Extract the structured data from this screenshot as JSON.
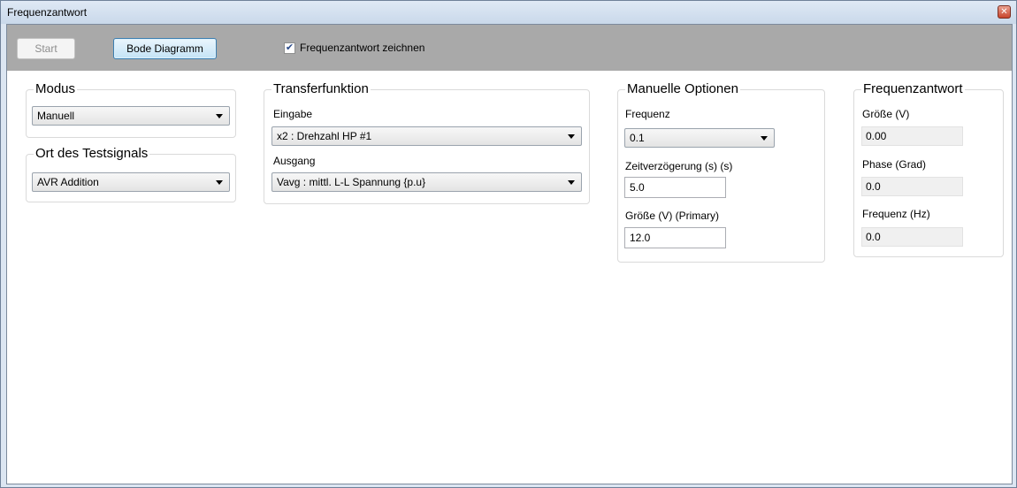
{
  "window": {
    "title": "Frequenzantwort"
  },
  "toolbar": {
    "start_label": "Start",
    "bode_label": "Bode Diagramm",
    "draw_checkbox_label": "Frequenzantwort zeichnen",
    "draw_checkbox_checked": true
  },
  "modus": {
    "title": "Modus",
    "selected": "Manuell"
  },
  "testsignal": {
    "title": "Ort des Testsignals",
    "selected": "AVR Addition"
  },
  "transfer": {
    "title": "Transferfunktion",
    "input_label": "Eingabe",
    "input_value": "x2 : Drehzahl HP #1",
    "output_label": "Ausgang",
    "output_value": "Vavg : mittl. L-L Spannung {p.u}"
  },
  "manual": {
    "title": "Manuelle Optionen",
    "freq_label": "Frequenz",
    "freq_value": "0.1",
    "delay_label": "Zeitverzögerung (s) (s)",
    "delay_value": "5.0",
    "size_label": "Größe (V) (Primary)",
    "size_value": "12.0"
  },
  "response": {
    "title": "Frequenzantwort",
    "size_label": "Größe (V)",
    "size_value": "0.00",
    "phase_label": "Phase (Grad)",
    "phase_value": "0.0",
    "freq_label": "Frequenz (Hz)",
    "freq_value": "0.0"
  }
}
